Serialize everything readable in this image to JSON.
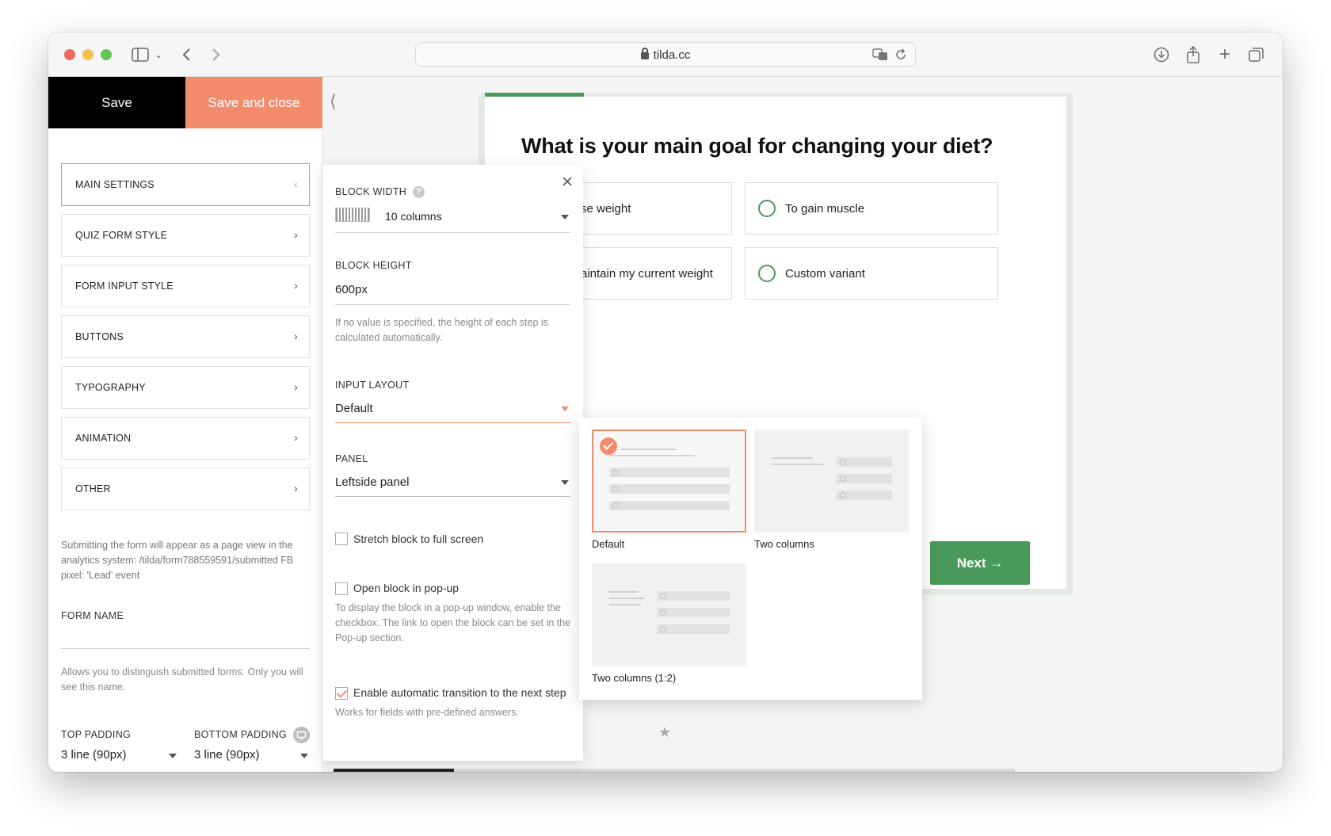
{
  "browser": {
    "url": "tilda.cc",
    "colors": {
      "close": "#ed6a5e",
      "minimize": "#f5bf4f",
      "maximize": "#61c554"
    }
  },
  "left_panel": {
    "save_label": "Save",
    "save_close_label": "Save and close",
    "menu": [
      {
        "label": "MAIN SETTINGS",
        "active": true
      },
      {
        "label": "QUIZ FORM STYLE"
      },
      {
        "label": "FORM INPUT STYLE"
      },
      {
        "label": "BUTTONS"
      },
      {
        "label": "TYPOGRAPHY"
      },
      {
        "label": "ANIMATION"
      },
      {
        "label": "OTHER"
      }
    ],
    "info_text": "Submitting the form will appear as a page view in the analytics system: /tilda/form788559591/submitted FB pixel: 'Lead' event",
    "form_name_label": "FORM NAME",
    "form_name_hint": "Allows you to distinguish submitted forms. Only you will see this name.",
    "top_padding_label": "TOP PADDING",
    "top_padding_value": "3 line (90px)",
    "bottom_padding_label": "BOTTOM PADDING",
    "bottom_padding_value": "3 line (90px)"
  },
  "mid_panel": {
    "block_width_label": "BLOCK WIDTH",
    "block_width_value": "10 columns",
    "block_height_label": "BLOCK HEIGHT",
    "block_height_value": "600px",
    "block_height_hint": "If no value is specified, the height of each step is calculated automatically.",
    "input_layout_label": "INPUT LAYOUT",
    "input_layout_value": "Default",
    "panel_label": "PANEL",
    "panel_value": "Leftside panel",
    "stretch_label": "Stretch block to full screen",
    "popup_label": "Open block in pop-up",
    "popup_hint": "To display the block in a pop-up window, enable the checkbox. The link to open the block can be set in the Pop-up section.",
    "auto_transition_label": "Enable automatic transition to the next step",
    "auto_transition_hint": "Works for fields with pre-defined answers.",
    "auto_transition_checked": true
  },
  "quiz": {
    "question": "What is your main goal for changing your diet?",
    "options": [
      "se weight",
      "To gain muscle",
      "aintain my current weight",
      "Custom variant"
    ],
    "next_label": "Next →",
    "progress": 0.17,
    "accent": "#4a9a5c"
  },
  "layout_chooser": {
    "options": [
      "Default",
      "Two columns",
      "Two columns (1:2)"
    ],
    "selected": "Default",
    "accent": "#f28c6c"
  }
}
